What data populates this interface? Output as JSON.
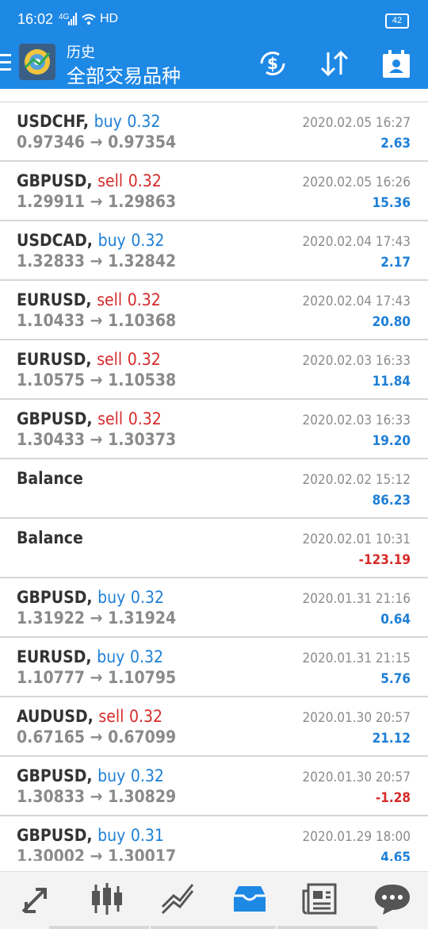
{
  "status_bar": {
    "time": "16:02",
    "network": "4G",
    "hd": "HD",
    "battery": "42"
  },
  "header": {
    "title_small": "历史",
    "title_large": "全部交易品种"
  },
  "toolbar_icons": [
    "currency-exchange-icon",
    "sort-icon",
    "calendar-icon"
  ],
  "colors": {
    "header_bg": "#1e88e5",
    "buy": "#1e7fd6",
    "sell": "#d62b2b",
    "profit_positive": "#1e7fd6",
    "profit_negative": "#d62b2b"
  },
  "trades": [
    {
      "symbol": "USDCHF,",
      "side": "buy",
      "volume": "0.32",
      "open": "0.97346",
      "close": "0.97354",
      "date": "2020.02.05 16:27",
      "profit": "2.63"
    },
    {
      "symbol": "GBPUSD,",
      "side": "sell",
      "volume": "0.32",
      "open": "1.29911",
      "close": "1.29863",
      "date": "2020.02.05 16:26",
      "profit": "15.36"
    },
    {
      "symbol": "USDCAD,",
      "side": "buy",
      "volume": "0.32",
      "open": "1.32833",
      "close": "1.32842",
      "date": "2020.02.04 17:43",
      "profit": "2.17"
    },
    {
      "symbol": "EURUSD,",
      "side": "sell",
      "volume": "0.32",
      "open": "1.10433",
      "close": "1.10368",
      "date": "2020.02.04 17:43",
      "profit": "20.80"
    },
    {
      "symbol": "EURUSD,",
      "side": "sell",
      "volume": "0.32",
      "open": "1.10575",
      "close": "1.10538",
      "date": "2020.02.03 16:33",
      "profit": "11.84"
    },
    {
      "symbol": "GBPUSD,",
      "side": "sell",
      "volume": "0.32",
      "open": "1.30433",
      "close": "1.30373",
      "date": "2020.02.03 16:33",
      "profit": "19.20"
    },
    {
      "symbol": "Balance",
      "side": "",
      "volume": "",
      "open": "",
      "close": "",
      "date": "2020.02.02 15:12",
      "profit": "86.23"
    },
    {
      "symbol": "Balance",
      "side": "",
      "volume": "",
      "open": "",
      "close": "",
      "date": "2020.02.01 10:31",
      "profit": "-123.19"
    },
    {
      "symbol": "GBPUSD,",
      "side": "buy",
      "volume": "0.32",
      "open": "1.31922",
      "close": "1.31924",
      "date": "2020.01.31 21:16",
      "profit": "0.64"
    },
    {
      "symbol": "EURUSD,",
      "side": "buy",
      "volume": "0.32",
      "open": "1.10777",
      "close": "1.10795",
      "date": "2020.01.31 21:15",
      "profit": "5.76"
    },
    {
      "symbol": "AUDUSD,",
      "side": "sell",
      "volume": "0.32",
      "open": "0.67165",
      "close": "0.67099",
      "date": "2020.01.30 20:57",
      "profit": "21.12"
    },
    {
      "symbol": "GBPUSD,",
      "side": "buy",
      "volume": "0.32",
      "open": "1.30833",
      "close": "1.30829",
      "date": "2020.01.30 20:57",
      "profit": "-1.28"
    },
    {
      "symbol": "GBPUSD,",
      "side": "buy",
      "volume": "0.31",
      "open": "1.30002",
      "close": "1.30017",
      "date": "2020.01.29 18:00",
      "profit": "4.65"
    }
  ],
  "bottom_nav": [
    {
      "name": "nav-quotes",
      "icon": "quotes-arrows-icon"
    },
    {
      "name": "nav-chart",
      "icon": "candlestick-icon"
    },
    {
      "name": "nav-trade",
      "icon": "trade-chart-icon"
    },
    {
      "name": "nav-history",
      "icon": "inbox-tray-icon",
      "active": true
    },
    {
      "name": "nav-news",
      "icon": "newspaper-icon"
    },
    {
      "name": "nav-chat",
      "icon": "chat-bubble-icon"
    }
  ]
}
